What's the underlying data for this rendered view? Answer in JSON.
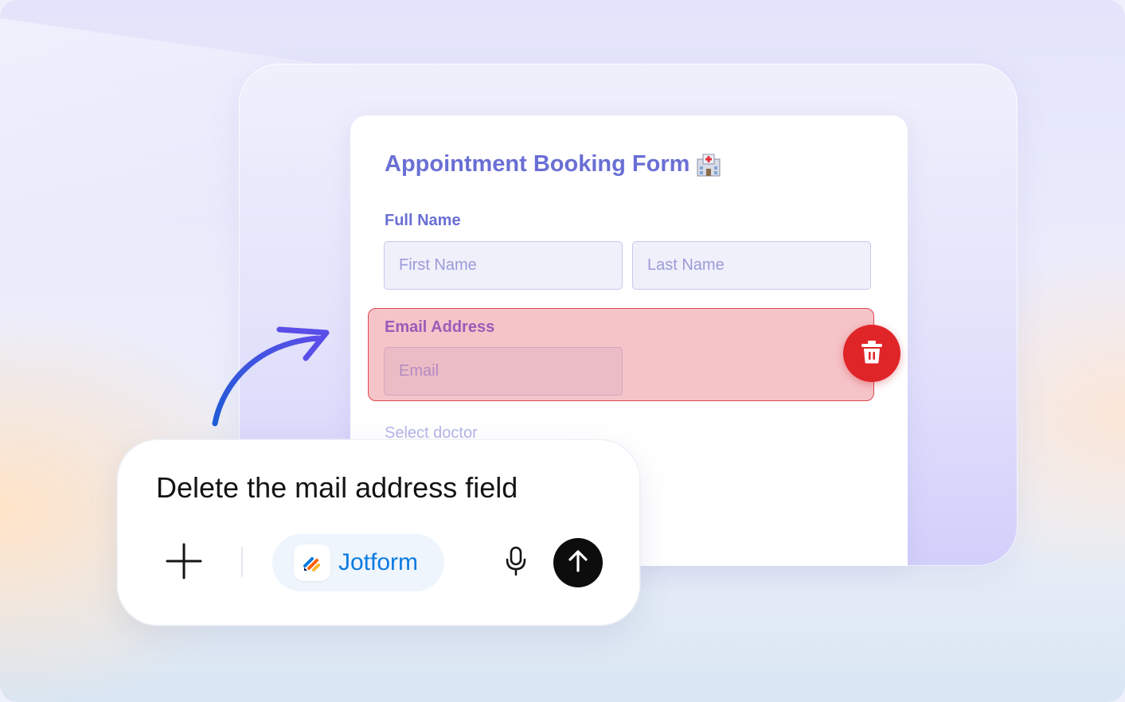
{
  "form": {
    "title": "Appointment Booking Form",
    "title_icon": "hospital-icon",
    "full_name_label": "Full Name",
    "first_name_placeholder": "First Name",
    "last_name_placeholder": "Last Name",
    "email_label": "Email Address",
    "email_placeholder": "Email",
    "select_doctor_label": "Select doctor",
    "delete_icon": "trash-icon",
    "colors": {
      "accent": "#6a6fd4",
      "highlight_fill": "#f5c4c8",
      "highlight_border": "#e0474f",
      "delete_button": "#e02529"
    }
  },
  "prompt": {
    "text": "Delete the mail address field",
    "add_icon": "plus-icon",
    "chip_label": "Jotform",
    "chip_icon": "jotform-logo-icon",
    "mic_icon": "microphone-icon",
    "send_icon": "arrow-up-icon",
    "colors": {
      "chip_text": "#0a7be0",
      "send_button": "#0d0d0d"
    }
  },
  "decoration": {
    "pointer_icon": "curved-arrow-icon"
  }
}
